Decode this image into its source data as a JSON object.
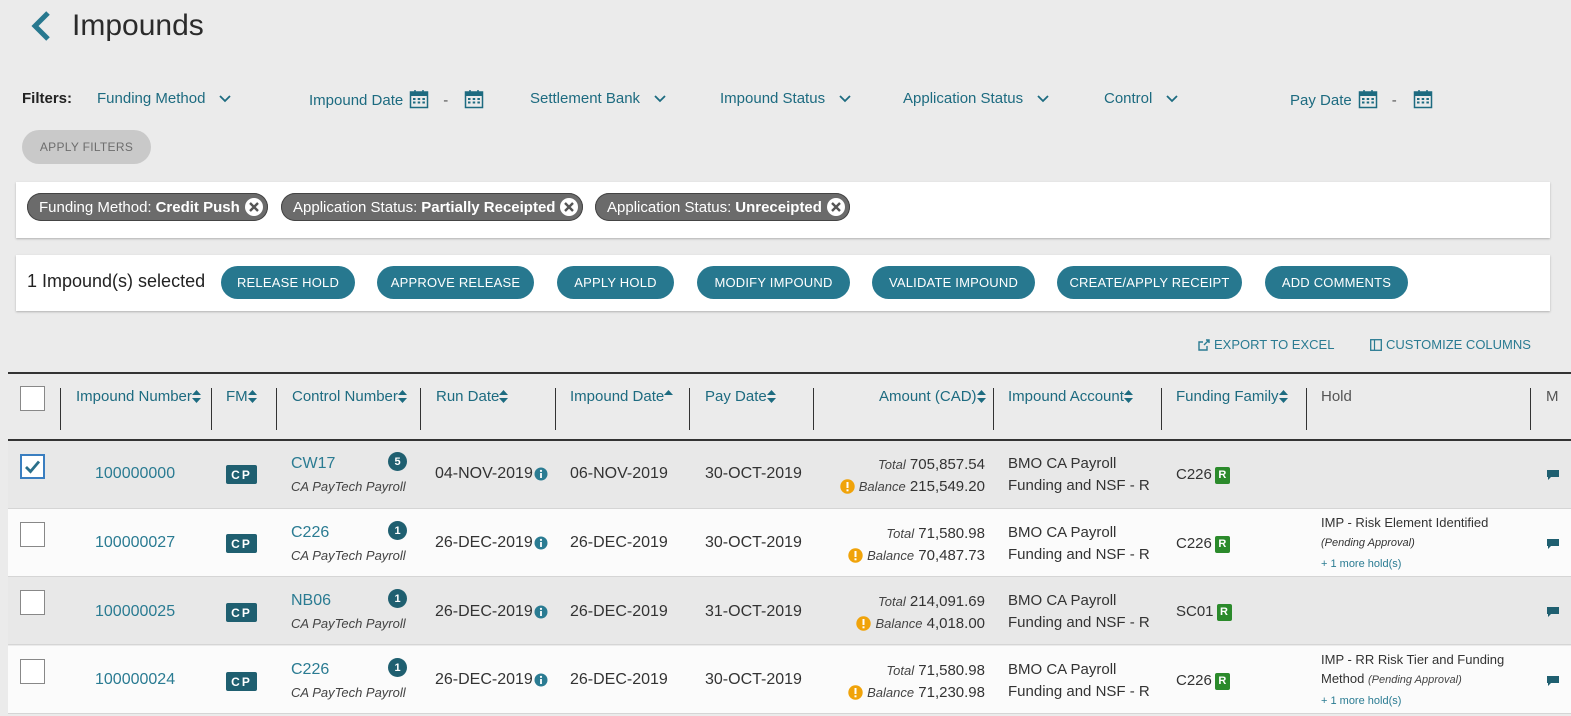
{
  "page": {
    "title": "Impounds"
  },
  "filters": {
    "label": "Filters:",
    "funding_method": "Funding Method",
    "impound_date": "Impound Date",
    "settlement_bank": "Settlement Bank",
    "impound_status": "Impound Status",
    "application_status": "Application Status",
    "control": "Control",
    "pay_date": "Pay Date",
    "range_dash": "-",
    "apply_label": "APPLY FILTERS"
  },
  "chips": [
    {
      "key": "Funding Method:",
      "value": "Credit Push"
    },
    {
      "key": "Application Status:",
      "value": "Partially Receipted"
    },
    {
      "key": "Application Status:",
      "value": "Unreceipted"
    }
  ],
  "actions": {
    "selected_text": "1 Impound(s) selected",
    "buttons": [
      "RELEASE HOLD",
      "APPROVE RELEASE",
      "APPLY HOLD",
      "MODIFY IMPOUND",
      "VALIDATE IMPOUND",
      "CREATE/APPLY RECEIPT",
      "ADD COMMENTS"
    ]
  },
  "toolbar": {
    "export": "EXPORT TO EXCEL",
    "customize": "CUSTOMIZE COLUMNS"
  },
  "table": {
    "columns": {
      "impound_number": "Impound Number",
      "fm": "FM",
      "control_number": "Control Number",
      "run_date": "Run Date",
      "impound_date": "Impound Date",
      "pay_date": "Pay Date",
      "amount": "Amount (CAD)",
      "impound_account": "Impound Account",
      "funding_family": "Funding Family",
      "hold": "Hold",
      "more": "M"
    },
    "labels": {
      "total": "Total",
      "balance": "Balance"
    },
    "rows": [
      {
        "checked": true,
        "impound_number": "100000000",
        "fm": "CP",
        "control": "CW17",
        "count": "5",
        "payroll": "CA PayTech Payroll",
        "run_date": "04-NOV-2019",
        "impound_date": "06-NOV-2019",
        "pay_date": "30-OCT-2019",
        "total": "705,857.54",
        "balance": "215,549.20",
        "account_line1": "BMO CA Payroll",
        "account_line2": "Funding and NSF - R",
        "family": "C226",
        "family_badge": "R",
        "hold": "",
        "hold_status": "",
        "hold_more": ""
      },
      {
        "checked": false,
        "impound_number": "100000027",
        "fm": "CP",
        "control": "C226",
        "count": "1",
        "payroll": "CA PayTech Payroll",
        "run_date": "26-DEC-2019",
        "impound_date": "26-DEC-2019",
        "pay_date": "30-OCT-2019",
        "total": "71,580.98",
        "balance": "70,487.73",
        "account_line1": "BMO CA Payroll",
        "account_line2": "Funding and NSF - R",
        "family": "C226",
        "family_badge": "R",
        "hold": "IMP - Risk Element Identified",
        "hold_status": "(Pending Approval)",
        "hold_more": "+ 1 more hold(s)"
      },
      {
        "checked": false,
        "impound_number": "100000025",
        "fm": "CP",
        "control": "NB06",
        "count": "1",
        "payroll": "CA PayTech Payroll",
        "run_date": "26-DEC-2019",
        "impound_date": "26-DEC-2019",
        "pay_date": "31-OCT-2019",
        "total": "214,091.69",
        "balance": "4,018.00",
        "account_line1": "BMO CA Payroll",
        "account_line2": "Funding and NSF - R",
        "family": "SC01",
        "family_badge": "R",
        "hold": "",
        "hold_status": "",
        "hold_more": ""
      },
      {
        "checked": false,
        "impound_number": "100000024",
        "fm": "CP",
        "control": "C226",
        "count": "1",
        "payroll": "CA PayTech Payroll",
        "run_date": "26-DEC-2019",
        "impound_date": "26-DEC-2019",
        "pay_date": "30-OCT-2019",
        "total": "71,580.98",
        "balance": "71,230.98",
        "account_line1": "BMO CA Payroll",
        "account_line2": "Funding and NSF - R",
        "family": "C226",
        "family_badge": "R",
        "hold": "IMP - RR Risk Tier and Funding Method",
        "hold_status": "(Pending Approval)",
        "hold_more": "+ 1 more hold(s)"
      }
    ]
  },
  "colors": {
    "teal": "#1d6b80",
    "button": "#27788f",
    "badge": "#1f5f70",
    "green": "#2b8a2b",
    "warn": "#f0a30a"
  }
}
